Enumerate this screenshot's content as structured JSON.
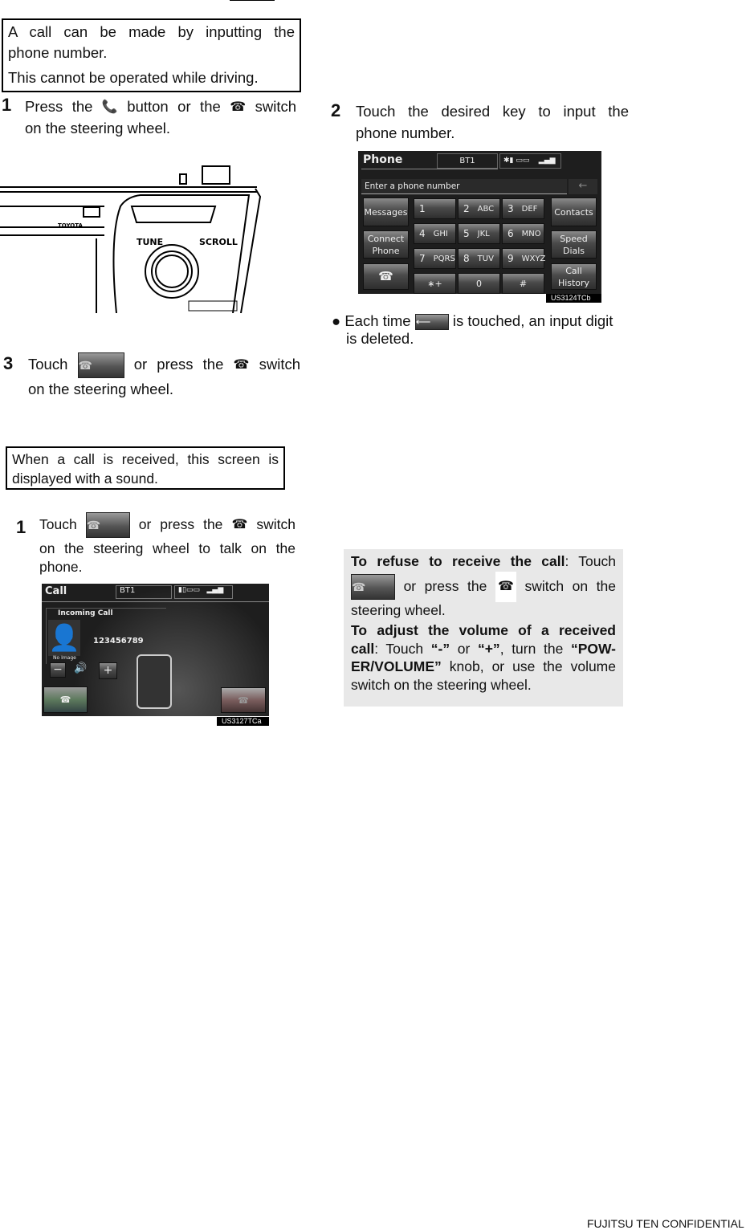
{
  "intro_box": {
    "line1": "A call can be made by inputting the",
    "line2": "phone number.",
    "line3": "This cannot be operated while driving."
  },
  "step1": {
    "number": "1",
    "part1": "Press the",
    "part2": "button or the",
    "part3": "switch",
    "line2": "on the steering wheel."
  },
  "panel": {
    "tune": "TUNE",
    "scroll": "SCROLL"
  },
  "step2": {
    "number": "2",
    "line1": "Touch the desired key to input the",
    "line2": "phone number."
  },
  "phone_screen": {
    "title": "Phone",
    "device": "BT1",
    "input_placeholder": "Enter a phone number",
    "left_buttons": [
      "Messages",
      "Connect Phone"
    ],
    "right_buttons": [
      "Contacts",
      "Speed Dials",
      "Call History"
    ],
    "keys": [
      {
        "d": "1",
        "l": ""
      },
      {
        "d": "2",
        "l": "ABC"
      },
      {
        "d": "3",
        "l": "DEF"
      },
      {
        "d": "4",
        "l": "GHI"
      },
      {
        "d": "5",
        "l": "JKL"
      },
      {
        "d": "6",
        "l": "MNO"
      },
      {
        "d": "7",
        "l": "PQRS"
      },
      {
        "d": "8",
        "l": "TUV"
      },
      {
        "d": "9",
        "l": "WXYZ"
      },
      {
        "d": "∗+",
        "l": ""
      },
      {
        "d": "0",
        "l": ""
      },
      {
        "d": "#",
        "l": ""
      }
    ],
    "code": "US3124TCb"
  },
  "bullet": {
    "part1": "Each time",
    "part2": "is touched, an input digit",
    "line2": "is deleted."
  },
  "step3": {
    "number": "3",
    "part1": "Touch",
    "part2": "or press the",
    "part3": "switch",
    "line2": "on the steering wheel."
  },
  "receive_box": {
    "line1": "When a call is received, this screen is",
    "line2": "displayed with a sound."
  },
  "step1b": {
    "number": "1",
    "part1": "Touch",
    "part2": "or press the",
    "part3": "switch",
    "line2": "on the steering wheel to talk on the",
    "line3": "phone."
  },
  "call_screen": {
    "title": "Call",
    "device": "BT1",
    "incoming": "Incoming Call",
    "number": "123456789",
    "no_image": "No Image",
    "minus": "−",
    "plus": "+",
    "code": "US3127TCa"
  },
  "note": {
    "refuse_bold": "To refuse to receive the call",
    "refuse_1": ": Touch",
    "refuse_2": "or press the",
    "refuse_3": "switch on the",
    "refuse_4": "steering wheel.",
    "vol_bold": "To adjust the volume of a received",
    "vol_bold2": "call",
    "vol_1": ": Touch",
    "vol_q1": "“-”",
    "vol_or": "or",
    "vol_q2": "“+”",
    "vol_2": ", turn the",
    "vol_q3": "“POW-",
    "vol_q4": "ER/VOLUME”",
    "vol_3": "knob, or use the volume",
    "vol_4": "switch on the steering wheel."
  },
  "footer": "FUJITSU TEN CONFIDENTIAL"
}
